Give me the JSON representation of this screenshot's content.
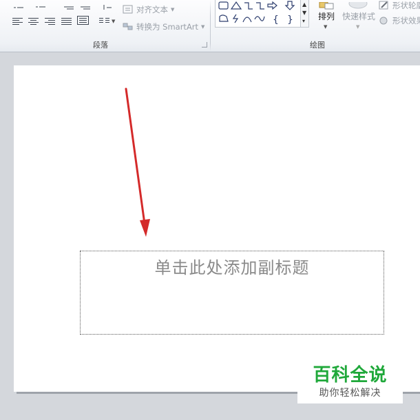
{
  "ribbon": {
    "paragraph_group": {
      "label": "段落",
      "text_direction_label": "对齐文本",
      "smartart_label": "转换为 SmartArt"
    },
    "drawing_group": {
      "label": "绘图",
      "arrange_label": "排列",
      "quick_styles_label": "快速样式",
      "shape_outline_label": "形状轮廓",
      "shape_effects_label": "形状效果",
      "shapes": [
        "rectangle-icon",
        "triangle-icon",
        "elbow-connector-icon",
        "elbow-arrow-icon",
        "right-arrow-icon",
        "down-arrow-icon",
        "freeform-icon",
        "lightning-icon",
        "arc-icon",
        "curve-icon",
        "left-brace-icon",
        "right-brace-icon"
      ]
    }
  },
  "slide": {
    "subtitle_placeholder": "单击此处添加副标题"
  },
  "watermark": {
    "title": "百科全说",
    "subtitle": "助你轻松解决"
  },
  "colors": {
    "annotation_arrow": "#d42a2a",
    "watermark_green": "#1fa83a"
  }
}
